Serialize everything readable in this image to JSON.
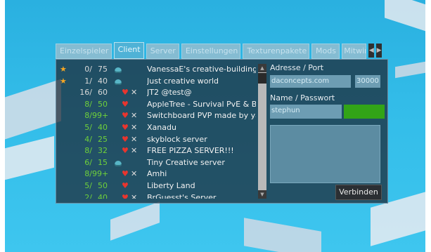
{
  "tabs": [
    {
      "label": "Einzelspieler",
      "active": false
    },
    {
      "label": "Client",
      "active": true
    },
    {
      "label": "Server",
      "active": false
    },
    {
      "label": "Einstellungen",
      "active": false
    },
    {
      "label": "Texturenpakete",
      "active": false
    },
    {
      "label": "Mods",
      "active": false
    },
    {
      "label": "Mitwirken",
      "active": false
    }
  ],
  "tab_arrows": {
    "left": "◀",
    "right": "▶"
  },
  "servers": [
    {
      "fav": true,
      "players": "0",
      "max": "75",
      "pcolor": "plain",
      "icons": [
        "face"
      ],
      "name": "VanessaE's creative-building"
    },
    {
      "fav": true,
      "players": "1",
      "max": "40",
      "pcolor": "plain",
      "icons": [
        "face"
      ],
      "name": "Just creative world"
    },
    {
      "fav": false,
      "players": "16",
      "max": "60",
      "pcolor": "plain",
      "icons": [
        "heart",
        "sword"
      ],
      "name": "JT2  @test@"
    },
    {
      "fav": false,
      "players": "8",
      "max": "50",
      "pcolor": "lime",
      "icons": [
        "heart"
      ],
      "name": "AppleTree - Survival PvE & B"
    },
    {
      "fav": false,
      "players": "8",
      "max": "99+",
      "pcolor": "lime",
      "icons": [
        "heart",
        "sword"
      ],
      "name": "Switchboard PVP made by ya"
    },
    {
      "fav": false,
      "players": "5",
      "max": "40",
      "pcolor": "lime",
      "icons": [
        "heart",
        "sword"
      ],
      "name": "Xanadu"
    },
    {
      "fav": false,
      "players": "4",
      "max": "25",
      "pcolor": "lime",
      "icons": [
        "heart",
        "sword"
      ],
      "name": "skyblock server"
    },
    {
      "fav": false,
      "players": "8",
      "max": "32",
      "pcolor": "lime",
      "icons": [
        "heart",
        "sword"
      ],
      "name": "FREE PIZZA SERVER!!!"
    },
    {
      "fav": false,
      "players": "6",
      "max": "15",
      "pcolor": "lime",
      "icons": [
        "face"
      ],
      "name": "Tiny Creative server"
    },
    {
      "fav": false,
      "players": "8",
      "max": "99+",
      "pcolor": "lime",
      "icons": [
        "heart",
        "sword"
      ],
      "name": "Amhi"
    },
    {
      "fav": false,
      "players": "5",
      "max": "50",
      "pcolor": "lime",
      "icons": [
        "heart"
      ],
      "name": "Liberty Land"
    },
    {
      "fav": false,
      "players": "2",
      "max": "40",
      "pcolor": "lime",
      "icons": [
        "heart",
        "sword"
      ],
      "name": "BrGuesst's Server"
    }
  ],
  "right": {
    "address_label": "Adresse / Port",
    "address_value": "daconcepts.com",
    "port_value": "30000",
    "name_label": "Name / Passwort",
    "name_value": "stephun",
    "connect_label": "Verbinden"
  },
  "scroll": {
    "up": "▲",
    "down": "▼"
  },
  "colors": {
    "fav_star": "#f5a623",
    "heart": "#e8352e",
    "lime": "#6fd13a",
    "password_field": "#32a417"
  }
}
